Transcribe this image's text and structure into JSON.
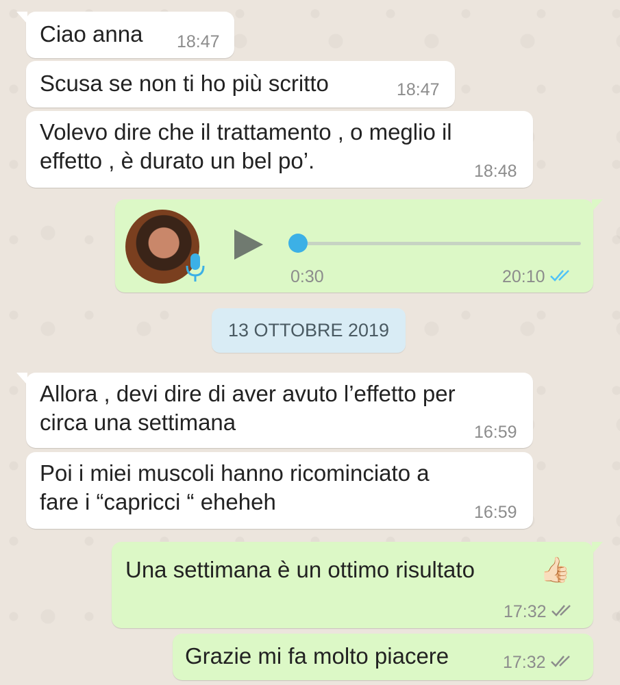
{
  "messages": [
    {
      "text": "Ciao anna",
      "time": "18:47"
    },
    {
      "text": "Scusa se non ti ho più scritto",
      "time": "18:47"
    },
    {
      "line1": "Volevo dire che il trattamento , o meglio il",
      "line2": "effetto , è durato un bel po’.",
      "time": "18:48"
    },
    {
      "duration": "0:30",
      "time": "20:10",
      "status": "read",
      "progress": 0
    },
    {
      "line1": "Allora , devi dire di aver avuto l’effetto per",
      "line2": "circa una settimana",
      "time": "16:59"
    },
    {
      "line1": "Poi i miei muscoli hanno ricominciato a",
      "line2": "fare i “capricci “ eheheh",
      "time": "16:59"
    },
    {
      "text": "Una settimana è un ottimo risultato",
      "emoji": "👍🏻",
      "time": "17:32",
      "status": "delivered"
    },
    {
      "text": "Grazie mi fa molto piacere",
      "time": "17:32",
      "status": "delivered"
    }
  ],
  "date_separator": "13 OTTOBRE 2019",
  "colors": {
    "incoming_bubble": "#ffffff",
    "outgoing_bubble": "#dcf8c6",
    "read_ticks": "#4fc3f7",
    "delivered_ticks": "#8c8c8c",
    "chat_background": "#ece5dd",
    "date_chip": "#d9ecf5"
  },
  "icons": {
    "play": "play-icon",
    "mic": "mic-icon",
    "ticks": "double-check-icon"
  }
}
